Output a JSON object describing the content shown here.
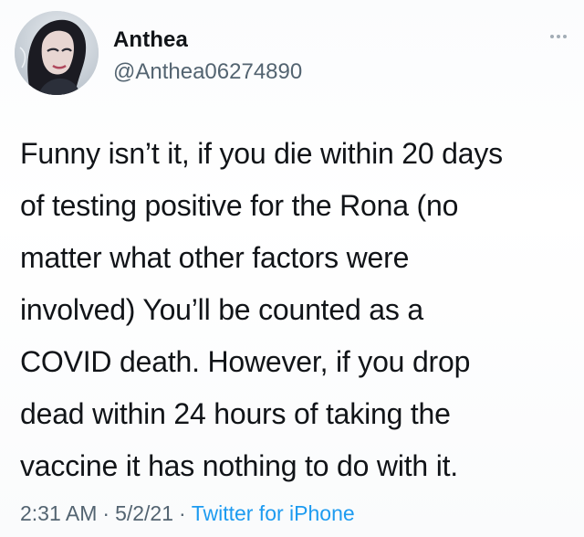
{
  "author": {
    "display_name": "Anthea",
    "handle": "@Anthea06274890"
  },
  "tweet": {
    "lines": [
      "Funny isn’t it, if you die within 20 days",
      "of testing positive for the Rona (no",
      "matter what other factors were",
      "involved) You’ll be counted as a",
      "COVID death. However, if you drop",
      "dead within 24 hours of taking the",
      "vaccine it has nothing to do with it."
    ]
  },
  "meta": {
    "time": "2:31 AM",
    "separator": "·",
    "date": "5/2/21",
    "source": "Twitter for iPhone"
  },
  "icons": {
    "more": "more-horizontal-icon"
  },
  "colors": {
    "text": "#111418",
    "secondary": "#536471",
    "link": "#1d9bf0"
  }
}
